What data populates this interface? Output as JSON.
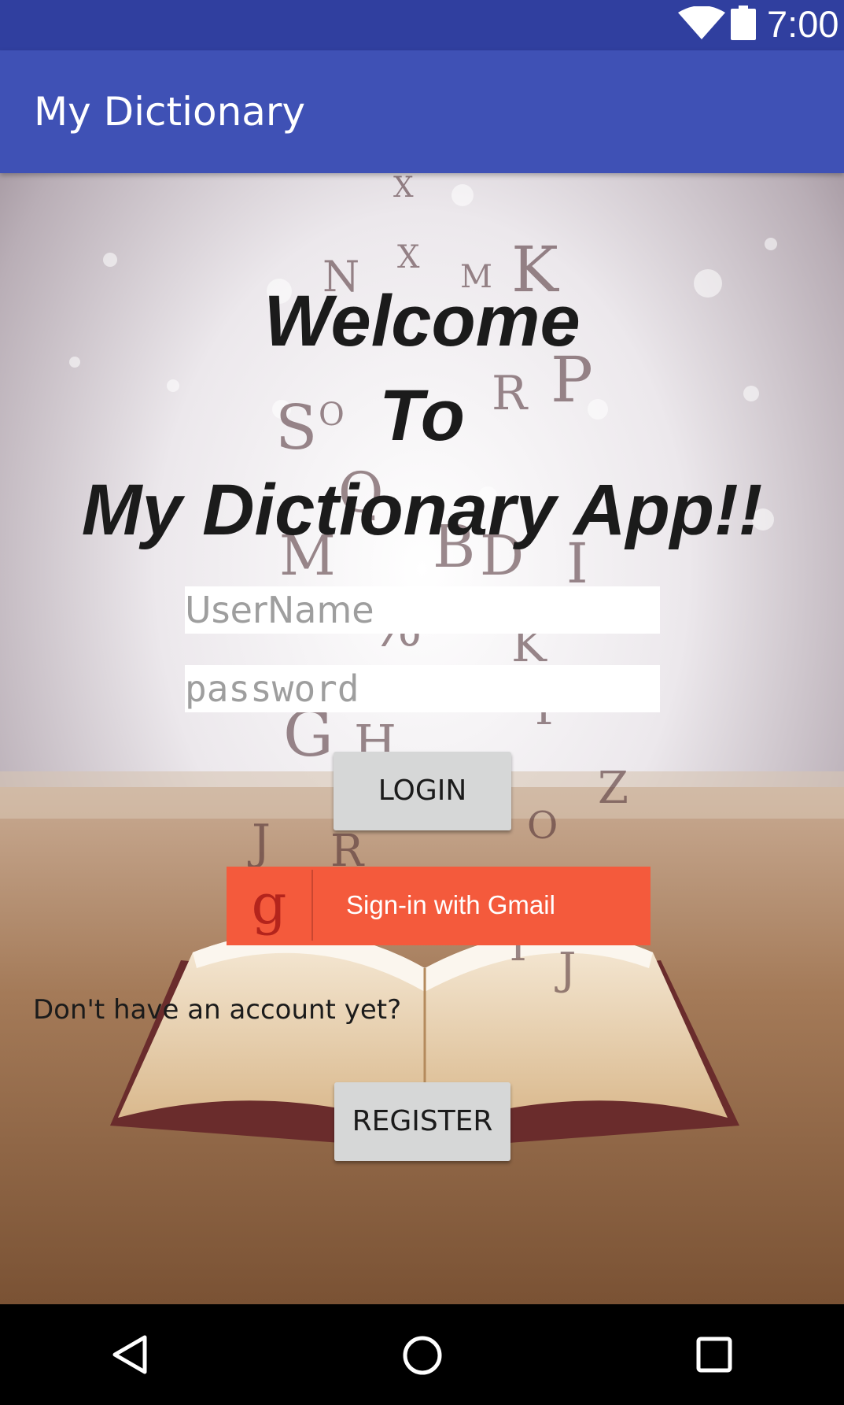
{
  "status_bar": {
    "time": "7:00",
    "icons": [
      "wifi-icon",
      "battery-icon"
    ],
    "color": "#303f9f"
  },
  "app_bar": {
    "title": "My Dictionary",
    "color": "#3f51b5"
  },
  "welcome": {
    "line1": "Welcome",
    "line2": "To",
    "line3": "My Dictionary App!!"
  },
  "form": {
    "username_placeholder": "UserName",
    "password_placeholder": "password",
    "login_label": "LOGIN",
    "gmail_label": "Sign-in with Gmail",
    "gmail_icon": "g",
    "gmail_color": "#f45a3c",
    "no_account_text": "Don't have an account yet?",
    "register_label": "REGISTER"
  },
  "nav_bar": {
    "icons": [
      "back-icon",
      "home-icon",
      "recents-icon"
    ]
  }
}
